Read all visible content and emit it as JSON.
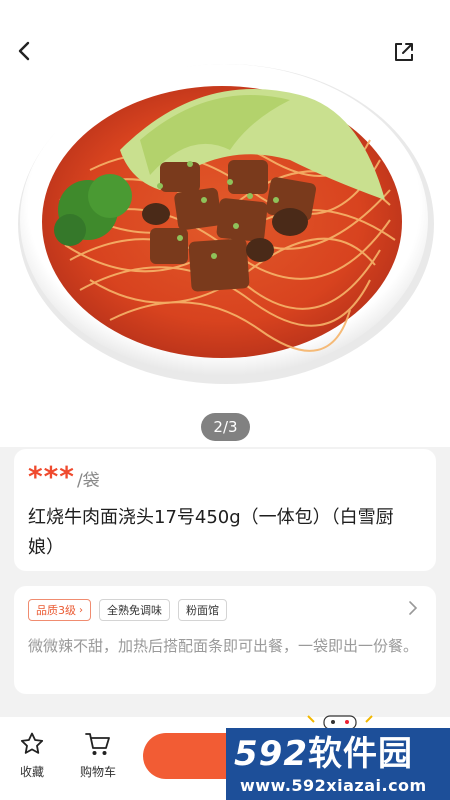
{
  "gallery": {
    "pager": "2/3"
  },
  "product": {
    "price_masked": "***",
    "unit": "/袋",
    "title": "红烧牛肉面浇头17号450g（一体包）（白雪厨娘）"
  },
  "info": {
    "tags": [
      "品质3级",
      "全熟免调味",
      "粉面馆"
    ],
    "description": "微微辣不甜，加热后搭配面条即可出餐，一袋即出一份餐。"
  },
  "bottom_bar": {
    "favorite_label": "收藏",
    "cart_label": "购物车"
  },
  "watermark": {
    "brand_num": "592",
    "brand_text": "软件园",
    "url": "www.592xiazai.com"
  },
  "icons": [
    "back-arrow-icon",
    "share-icon",
    "chevron-right-icon",
    "star-icon",
    "cart-icon"
  ],
  "colors": {
    "price": "#ef4a2e",
    "accent": "#f25c34",
    "watermark_bg": "#1d4f99"
  }
}
